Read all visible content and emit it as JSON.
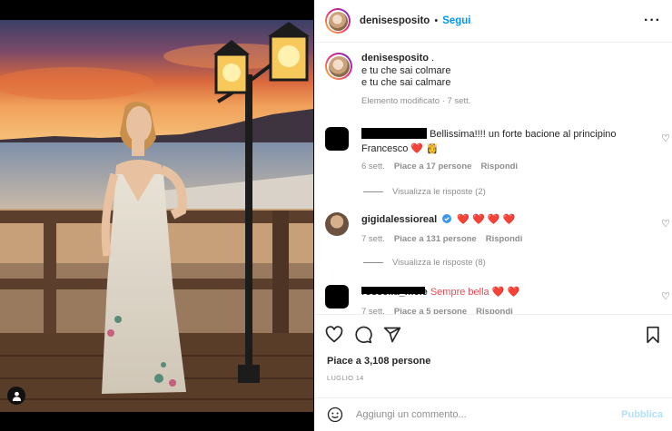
{
  "post": {
    "username": "denisesposito",
    "follow_label": "Segui",
    "more_icon": "more-dots-icon",
    "caption_username": "denisesposito",
    "caption_suffix": " .",
    "caption_line1": "e tu che sai colmare",
    "caption_line2": "e tu che sai calmare",
    "caption_meta": "Elemento modificato · 7 sett."
  },
  "comments": [
    {
      "text": "Bellissima!!!! un forte bacione al principino Francesco ❤️ 👸",
      "time": "6 sett.",
      "likes": "Piace a 17 persone",
      "reply": "Rispondi",
      "view_replies": "Visualizza le risposte (2)"
    },
    {
      "username": "gigidalessioreal",
      "verified": true,
      "text": "❤️ ❤️ ❤️ ❤️",
      "time": "7 sett.",
      "likes": "Piace a 131 persone",
      "reply": "Rispondi",
      "view_replies": "Visualizza le risposte (8)"
    },
    {
      "username_partial": "rossella_mele",
      "text": "Sempre bella ❤️ ❤️",
      "time": "7 sett.",
      "likes": "Piace a 5 persone",
      "reply": "Rispondi"
    }
  ],
  "footer": {
    "likes": "Piace a 3,108 persone",
    "date": "LUGLIO 14",
    "comment_placeholder": "Aggiungi un commento...",
    "publish_label": "Pubblica"
  },
  "colors": {
    "accent": "#0095f6",
    "publish_disabled": "#b2dffc",
    "heart": "#ed4956",
    "muted": "#8e8e8e"
  }
}
